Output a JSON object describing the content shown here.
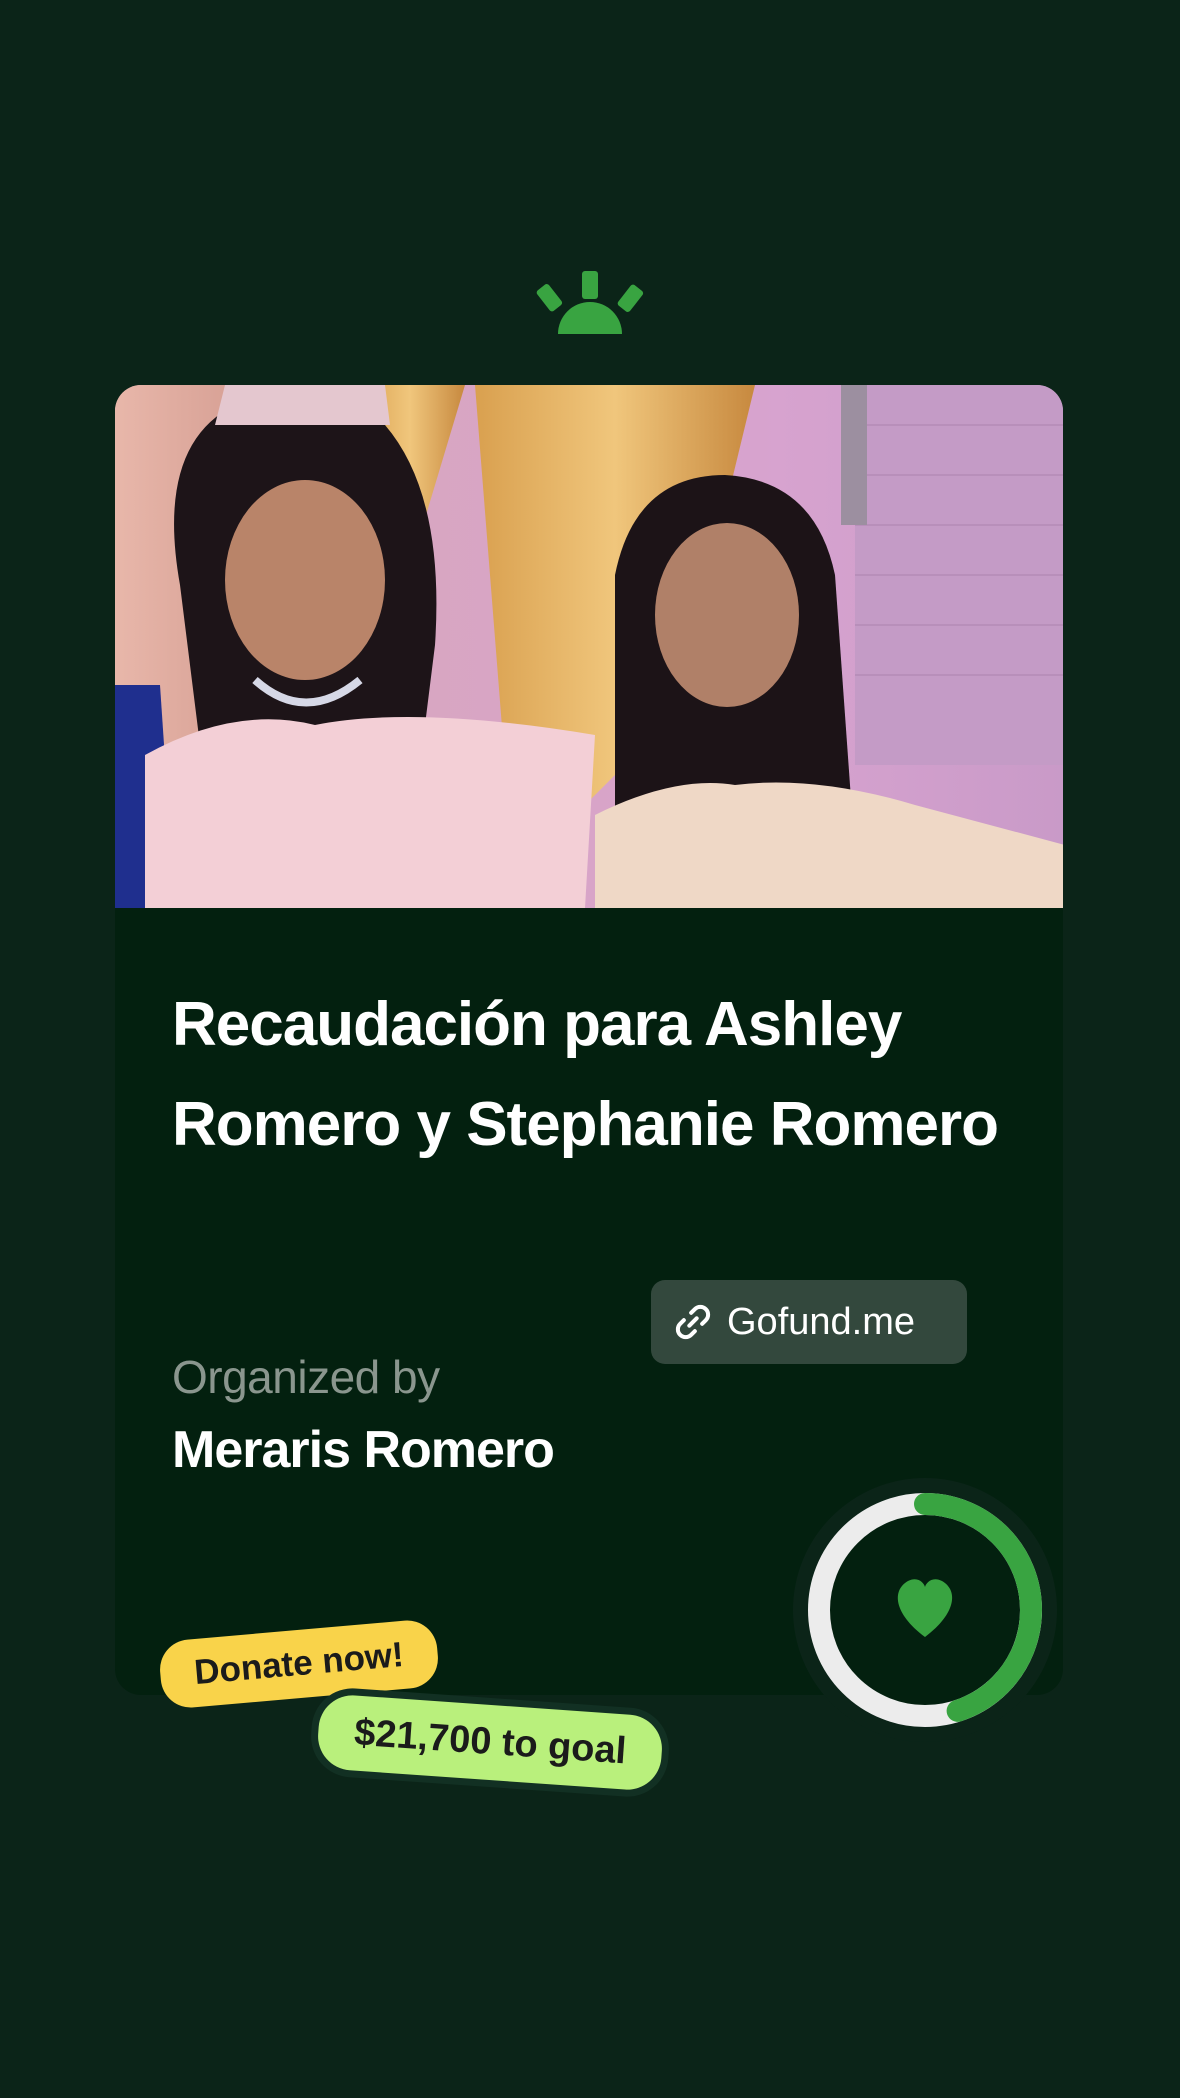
{
  "campaign": {
    "title": "Recaudación para Ashley Romero y Stephanie Romero",
    "link_label": "Gofund.me",
    "organized_by_label": "Organized by",
    "organizer": "Meraris Romero"
  },
  "stickers": {
    "donate": "Donate now!",
    "goal": "$21,700 to goal"
  },
  "progress": {
    "fraction_raised": 0.45
  },
  "icons": {
    "brand": "gofundme-sunrise-logo",
    "link": "link-icon",
    "heart": "heart-icon"
  },
  "colors": {
    "background": "#0b2418",
    "card": "#03200f",
    "accent_green": "#39a441",
    "donate_sticker": "#f9d34a",
    "goal_sticker": "#b9f07c"
  }
}
